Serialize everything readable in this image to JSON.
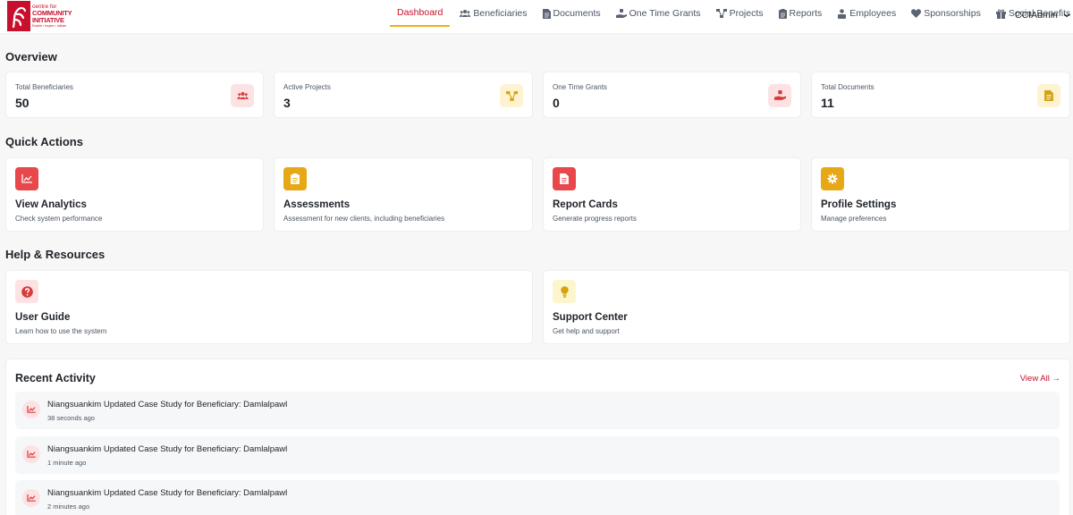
{
  "logo": {
    "line1": "centre for",
    "line2": "COMMUNITY",
    "line3": "INITIATIVE",
    "tagline": "Enable • Inspire • Initiate",
    "brand_color": "#c8102e"
  },
  "nav": {
    "items": [
      {
        "label": "Dashboard",
        "icon": "none",
        "active": true
      },
      {
        "label": "Beneficiaries",
        "icon": "users-icon"
      },
      {
        "label": "Documents",
        "icon": "document-icon"
      },
      {
        "label": "One Time Grants",
        "icon": "hand-holding-icon"
      },
      {
        "label": "Projects",
        "icon": "project-diagram-icon"
      },
      {
        "label": "Reports",
        "icon": "clipboard-icon"
      },
      {
        "label": "Employees",
        "icon": "user-group-icon"
      },
      {
        "label": "Sponsorships",
        "icon": "heart-icon"
      },
      {
        "label": "Social Benefits",
        "icon": "gift-icon"
      }
    ],
    "user": "CCIAdmin",
    "accent_color": "#e8b11c"
  },
  "overview": {
    "title": "Overview",
    "stats": [
      {
        "label": "Total Beneficiaries",
        "value": "50",
        "icon": "users-icon",
        "color": "#d93a3a",
        "bg": "#fde2e4"
      },
      {
        "label": "Active Projects",
        "value": "3",
        "icon": "project-diagram-icon",
        "color": "#d4a10f",
        "bg": "#fdf3d1"
      },
      {
        "label": "One Time Grants",
        "value": "0",
        "icon": "hand-holding-icon",
        "color": "#d93a3a",
        "bg": "#fde2e4"
      },
      {
        "label": "Total Documents",
        "value": "11",
        "icon": "document-icon",
        "color": "#d4a10f",
        "bg": "#fdf3d1"
      }
    ]
  },
  "quick_actions": {
    "title": "Quick Actions",
    "items": [
      {
        "title": "View Analytics",
        "desc": "Check system performance",
        "icon": "chart-line-icon",
        "color": "#e8474b"
      },
      {
        "title": "Assessments",
        "desc": "Assessment for new clients, including beneficiaries",
        "icon": "clipboard-list-icon",
        "color": "#e6a817"
      },
      {
        "title": "Report Cards",
        "desc": "Generate progress reports",
        "icon": "file-alt-icon",
        "color": "#e8474b"
      },
      {
        "title": "Profile Settings",
        "desc": "Manage preferences",
        "icon": "gear-icon",
        "color": "#e6a817"
      }
    ]
  },
  "help": {
    "title": "Help & Resources",
    "items": [
      {
        "title": "User Guide",
        "desc": "Learn how to use the system",
        "icon": "question-circle-icon",
        "color": "#d93a3a",
        "bg": "#fde2e4"
      },
      {
        "title": "Support Center",
        "desc": "Get help and support",
        "icon": "lightbulb-icon",
        "color": "#d4a10f",
        "bg": "#fdf6cc"
      }
    ]
  },
  "activity": {
    "title": "Recent Activity",
    "view_all": "View All →",
    "items": [
      {
        "text": "Niangsuankim Updated Case Study for Beneficiary: Damlalpawl",
        "time": "38 seconds ago"
      },
      {
        "text": "Niangsuankim Updated Case Study for Beneficiary: Damlalpawl",
        "time": "1 minute ago"
      },
      {
        "text": "Niangsuankim Updated Case Study for Beneficiary: Damlalpawl",
        "time": "2 minutes ago"
      }
    ]
  }
}
